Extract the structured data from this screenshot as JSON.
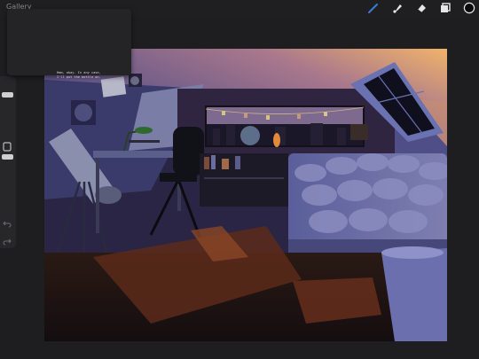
{
  "app": {
    "gallery_label": "Gallery",
    "accent_color": "#3a7bd5"
  },
  "toolbar": {
    "tools": [
      {
        "name": "brush-icon"
      },
      {
        "name": "smudge-icon"
      },
      {
        "name": "eraser-icon"
      },
      {
        "name": "layers-icon"
      },
      {
        "name": "color-swatch-icon"
      }
    ],
    "active_color": "#0a0a0a"
  },
  "popover": {
    "line1": "Hmm, okay. In any case,",
    "line2": "I'll put the bottle on."
  },
  "canvas": {
    "subject": "night attic bedroom illustration"
  }
}
